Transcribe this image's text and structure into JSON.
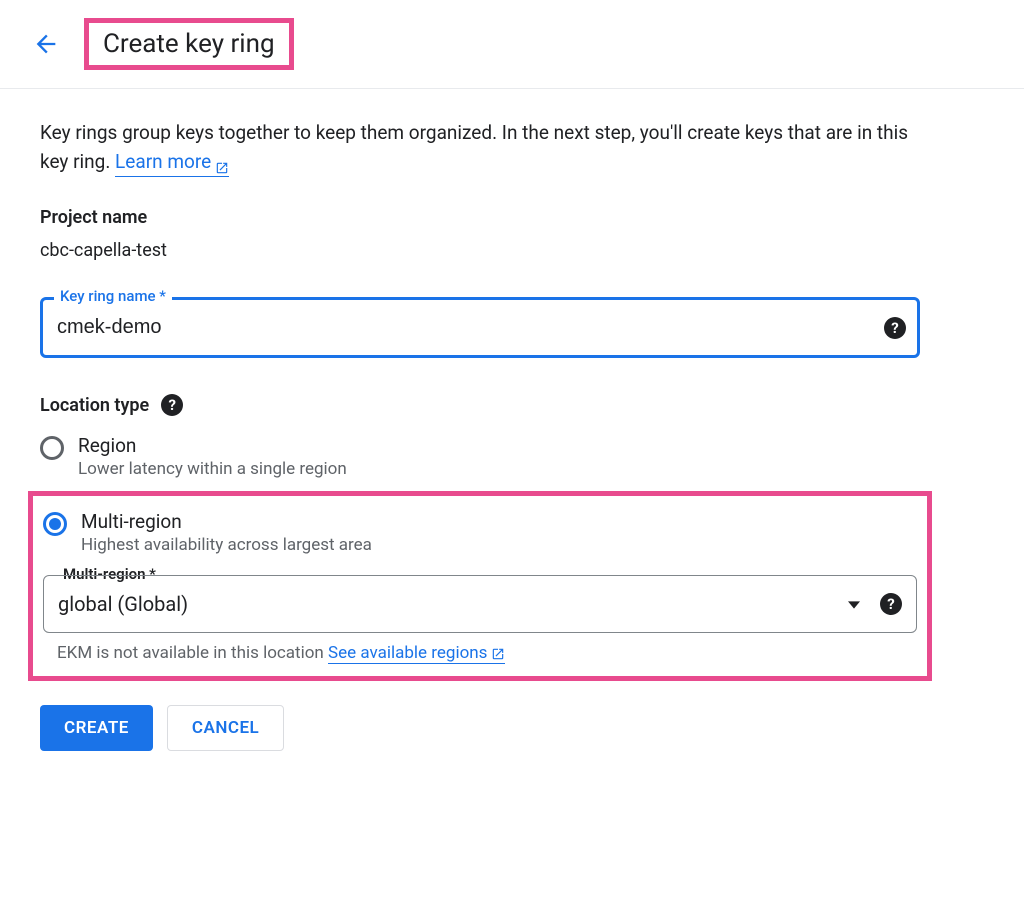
{
  "header": {
    "title": "Create key ring"
  },
  "description": {
    "text": "Key rings group keys together to keep them organized. In the next step, you'll create keys that are in this key ring. ",
    "learn_more": "Learn more"
  },
  "project": {
    "label": "Project name",
    "value": "cbc-capella-test"
  },
  "key_ring_name": {
    "label": "Key ring name *",
    "value": "cmek-demo"
  },
  "location_type": {
    "label": "Location type",
    "options": {
      "region": {
        "label": "Region",
        "desc": "Lower latency within a single region"
      },
      "multi": {
        "label": "Multi-region",
        "desc": "Highest availability across largest area"
      }
    }
  },
  "multi_region": {
    "label": "Multi-region *",
    "value": "global (Global)",
    "helper_prefix": "EKM is not available in this location ",
    "helper_link": "See available regions"
  },
  "buttons": {
    "create": "CREATE",
    "cancel": "CANCEL"
  }
}
